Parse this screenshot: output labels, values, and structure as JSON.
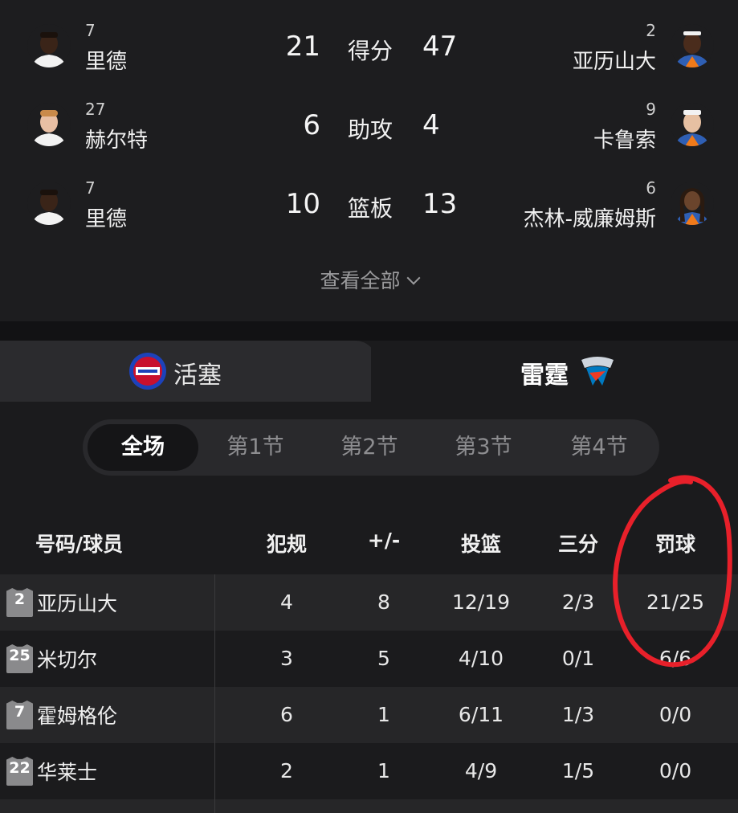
{
  "leaders": [
    {
      "left_player": {
        "number": "7",
        "name": "里德"
      },
      "left_value": "21",
      "stat": "得分",
      "right_value": "47",
      "right_player": {
        "number": "2",
        "name": "亚历山大"
      }
    },
    {
      "left_player": {
        "number": "27",
        "name": "赫尔特"
      },
      "left_value": "6",
      "stat": "助攻",
      "right_value": "4",
      "right_player": {
        "number": "9",
        "name": "卡鲁索"
      }
    },
    {
      "left_player": {
        "number": "7",
        "name": "里德"
      },
      "left_value": "10",
      "stat": "篮板",
      "right_value": "13",
      "right_player": {
        "number": "6",
        "name": "杰林-威廉姆斯"
      }
    }
  ],
  "view_all": "查看全部",
  "teams": {
    "left": "活塞",
    "right": "雷霆"
  },
  "periods": [
    "全场",
    "第1节",
    "第2节",
    "第3节",
    "第4节"
  ],
  "table": {
    "headers": [
      "号码/球员",
      "犯规",
      "+/-",
      "投篮",
      "三分",
      "罚球"
    ],
    "rows": [
      {
        "number": "2",
        "name": "亚历山大",
        "fouls": "4",
        "plus_minus": "8",
        "fg": "12/19",
        "three": "2/3",
        "ft": "21/25"
      },
      {
        "number": "25",
        "name": "米切尔",
        "fouls": "3",
        "plus_minus": "5",
        "fg": "4/10",
        "three": "0/1",
        "ft": "6/6"
      },
      {
        "number": "7",
        "name": "霍姆格伦",
        "fouls": "6",
        "plus_minus": "1",
        "fg": "6/11",
        "three": "1/3",
        "ft": "0/0"
      },
      {
        "number": "22",
        "name": "华莱士",
        "fouls": "2",
        "plus_minus": "1",
        "fg": "4/9",
        "three": "1/5",
        "ft": "0/0"
      }
    ]
  },
  "colors": {
    "background": "#1b1b1d",
    "annotation": "#e8202a",
    "pistons_red": "#c8102e",
    "pistons_blue": "#1d42ba",
    "thunder_blue": "#007ac1"
  }
}
